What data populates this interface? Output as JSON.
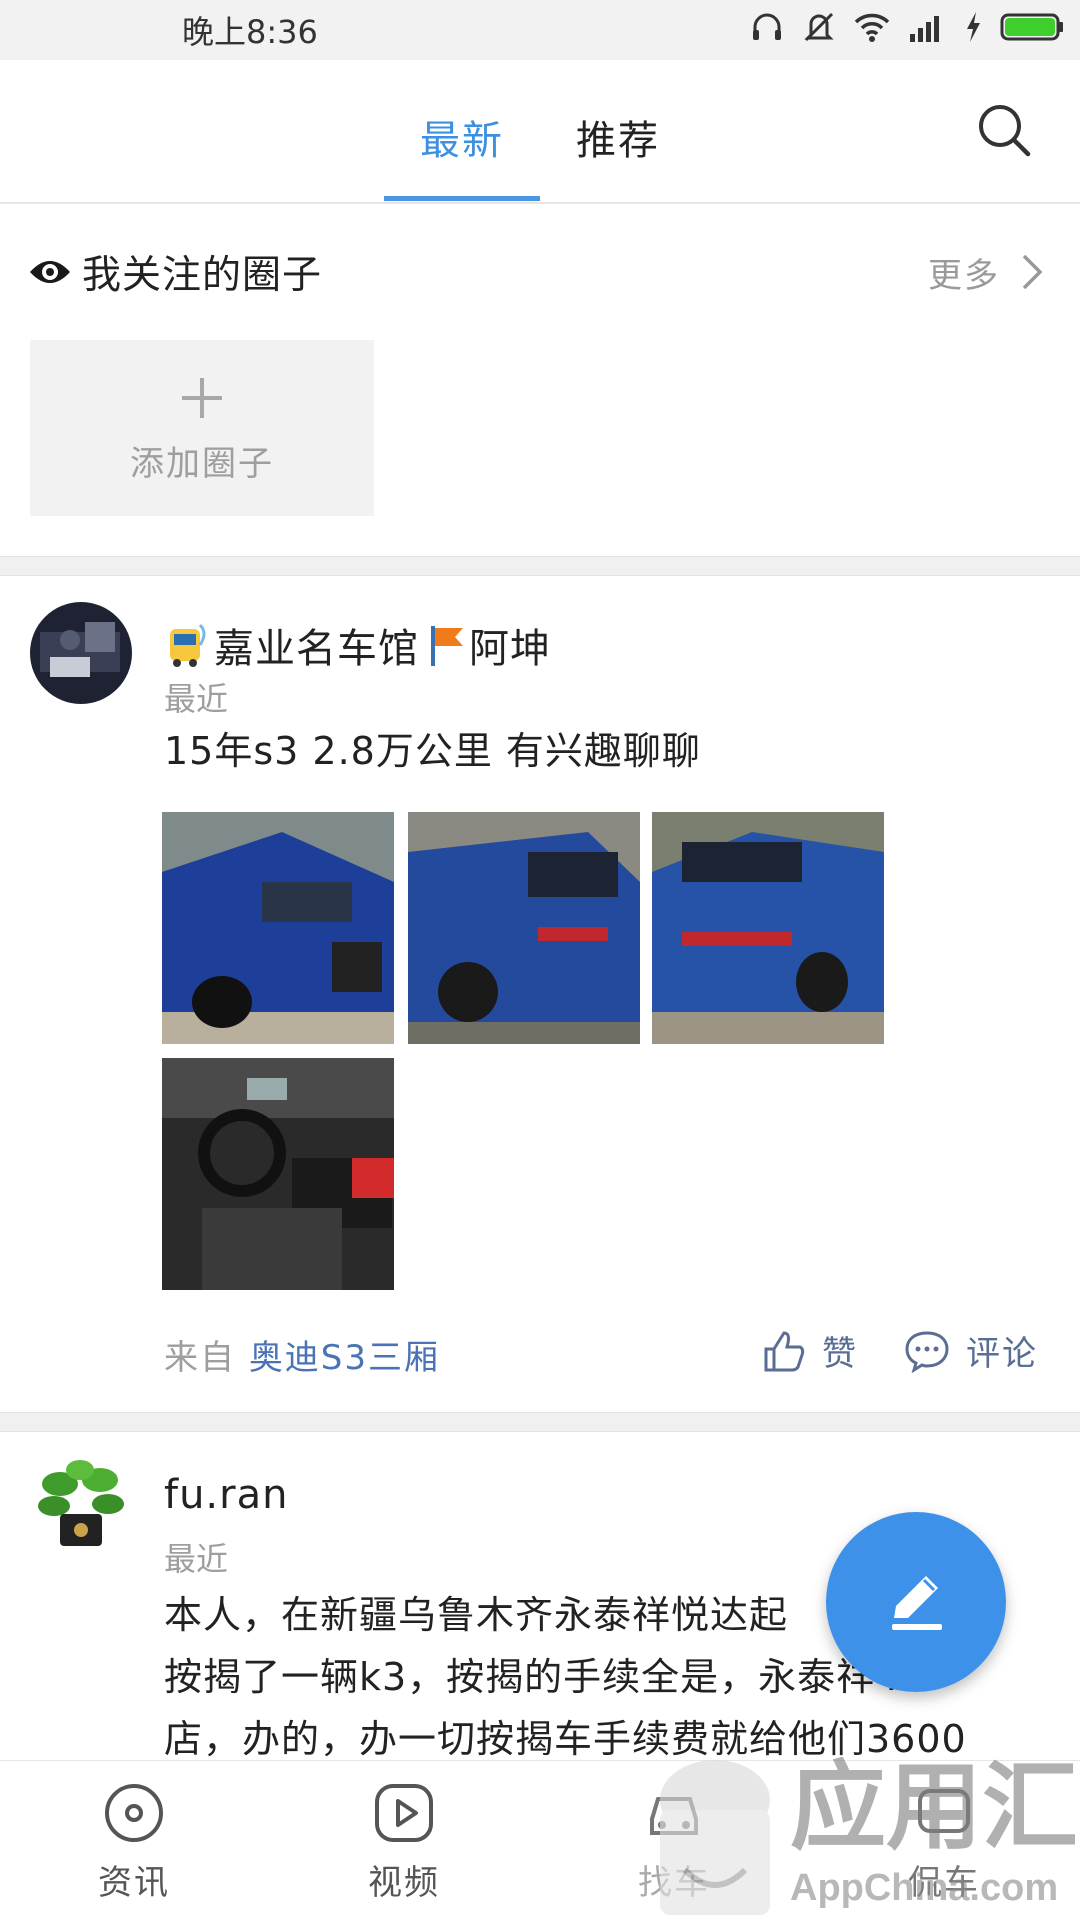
{
  "status_bar": {
    "time": "晚上8:36"
  },
  "top_tabs": {
    "tabs": [
      {
        "label": "最新"
      },
      {
        "label": "推荐"
      }
    ]
  },
  "followed": {
    "title": "我关注的圈子",
    "more": "更多",
    "add_label": "添加圈子"
  },
  "posts": [
    {
      "author": "嘉业名车馆",
      "author_suffix": "阿坤",
      "time": "最近",
      "content": "15年s3 2.8万公里 有兴趣聊聊",
      "from_prefix": "来自",
      "from_circle": "奥迪S3三厢",
      "like_label": "赞",
      "comment_label": "评论"
    },
    {
      "author": "fu.ran",
      "time": "最近",
      "content_lines": [
        "本人，在新疆乌鲁木齐永泰祥悦达起",
        "按揭了一辆k3，按揭的手续全是，永泰祥4S",
        "店，办的，办一切按揭车手续费就给他们3600"
      ]
    }
  ],
  "bottom_nav": {
    "items": [
      {
        "label": "资讯"
      },
      {
        "label": "视频"
      },
      {
        "label": "找车"
      },
      {
        "label": "侃车"
      }
    ]
  },
  "watermark": {
    "cn": "应用汇",
    "en": "AppChina.com"
  },
  "colors": {
    "accent": "#3d8fe0",
    "fab": "#3d91e8",
    "link": "#4a72b5"
  }
}
